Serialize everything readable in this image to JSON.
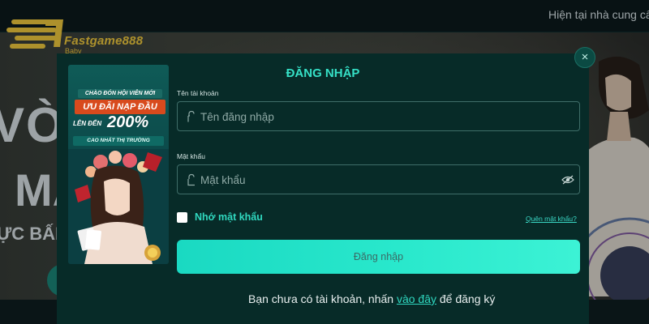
{
  "header": {
    "logo_text": "Fastgame888",
    "logo_sub": "Baby",
    "ticker": "Hiện tại nhà cung cấp"
  },
  "hero": {
    "line1": "VÒN",
    "line2": "MA",
    "line3": "ỰC BẤM"
  },
  "promo": {
    "line1": "CHÀO ĐÓN HỘI VIÊN MỚI",
    "line2": "ƯU ĐÃI NẠP ĐẦU",
    "line3": "LÊN ĐẾN",
    "percent": "200%",
    "line4": "CAO NHẤT THỊ TRƯỜNG"
  },
  "login": {
    "close": "×",
    "title": "ĐĂNG NHẬP",
    "username_label": "Tên tài khoản",
    "username_placeholder": "Tên đăng nhập",
    "username_value": "",
    "password_label": "Mật khẩu",
    "password_placeholder": "Mật khẩu",
    "password_value": "",
    "remember_label": "Nhớ mật khẩu",
    "remember_checked": false,
    "forgot_link": "Quên mật khẩu?",
    "submit_label": "Đăng nhập",
    "signup_text": "Bạn chưa có tài khoản, nhấn",
    "signup_link": "vào đây",
    "signup_suffix": "để đăng ký"
  },
  "colors": {
    "accent": "#35e0c6",
    "modal_bg": "#072b28",
    "logo": "#ffd23c",
    "button_gradient_start": "#1ad9c2",
    "button_gradient_end": "#3cf2d5"
  },
  "icons": [
    "lock-icon",
    "lock-icon",
    "eye-slash-icon",
    "close-icon"
  ]
}
